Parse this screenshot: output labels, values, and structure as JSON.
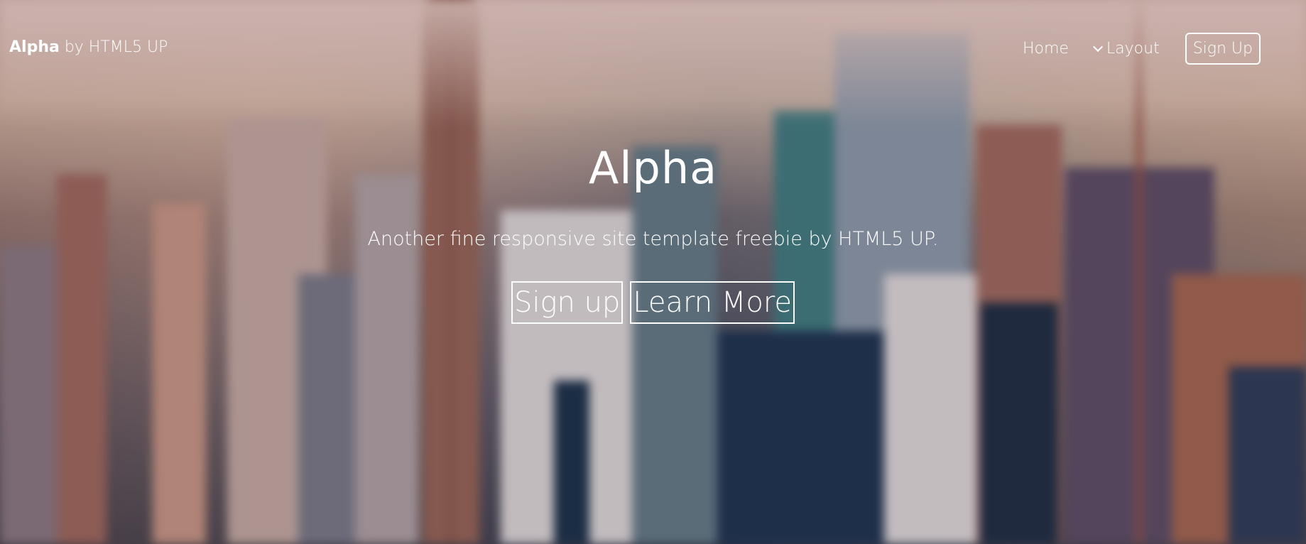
{
  "header": {
    "brand": "Alpha",
    "byline": "by HTML5 UP",
    "nav": {
      "home": "Home",
      "layout": "Layout",
      "signup": "Sign Up"
    }
  },
  "hero": {
    "title": "Alpha",
    "subtitle": "Another fine responsive site template freebie by HTML5 UP.",
    "buttons": {
      "primary": "Sign up",
      "secondary": "Learn More"
    }
  },
  "icons": {
    "layout_dropdown": "chevron-down-icon"
  },
  "colors": {
    "text": "#ffffff",
    "border": "#ffffff"
  }
}
